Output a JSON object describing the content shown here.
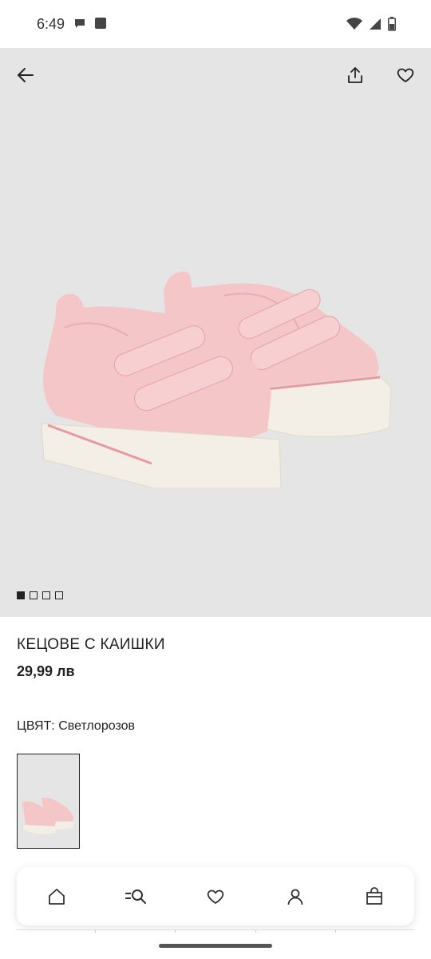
{
  "status_bar": {
    "time": "6:49"
  },
  "product": {
    "title": "КЕЦОВЕ С КАИШКИ",
    "price": "29,99 лв",
    "color_label": "ЦВЯТ: Светлорозов",
    "image_count": 4,
    "active_image_index": 1,
    "colors": {
      "shoe_pink": "#f4c6c8",
      "sole": "#f3efe6",
      "stripe": "#e79aa2",
      "background": "#e5e5e5"
    }
  },
  "icons": {
    "back": "arrow-left-icon",
    "share": "share-icon",
    "favorite": "heart-icon",
    "nav": [
      "home-icon",
      "search-icon",
      "heart-icon",
      "user-icon",
      "shopping-bag-icon"
    ]
  }
}
